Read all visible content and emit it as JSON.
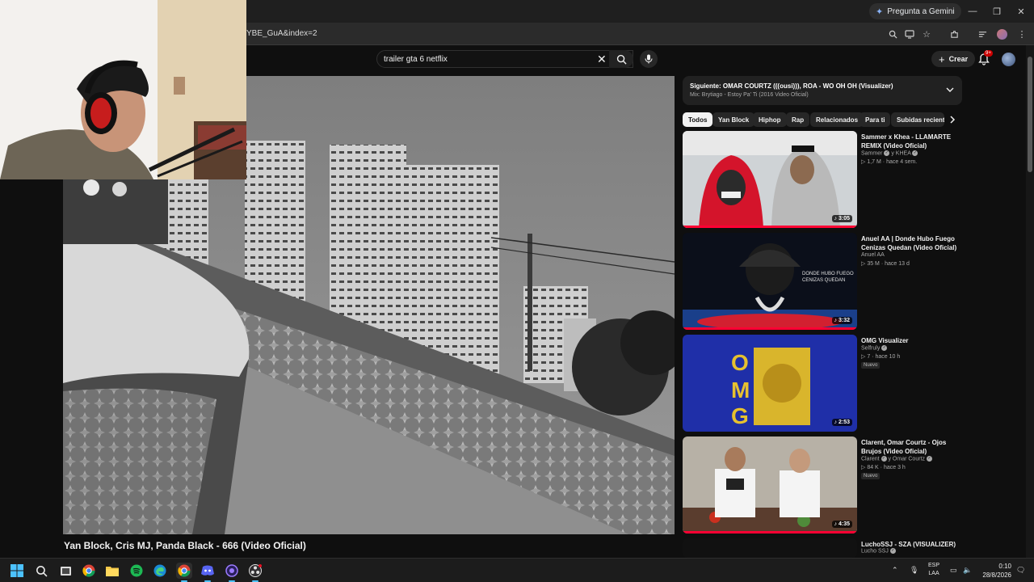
{
  "browser": {
    "gemini_label": "Pregunta a Gemini",
    "url_fragment": "YBE_GuA&index=2",
    "window_controls": [
      "minimize-icon",
      "restore-icon",
      "close-icon"
    ]
  },
  "youtube": {
    "search_value": "trailer gta 6 netflix",
    "create_label": "Crear",
    "notif_count": "9+",
    "video_title": "Yan Block, Cris MJ, Panda Black - 666 (Video Oficial)",
    "playlist": {
      "next": "Siguiente: OMAR COURTZ (((ousi))), ROA - WO OH OH (Visualizer)",
      "mix": "Mix: Brytiago - Estoy Pa' Ti (2016 Video Oficial)"
    },
    "chips": [
      "Todos",
      "Yan Block",
      "Hiphop",
      "Rap",
      "Relacionados",
      "Para ti",
      "Subidas recientes"
    ],
    "recommendations": [
      {
        "title": "Sammer x Khea - LLAMARTE REMIX (Video Oficial)",
        "channel": "Sammer",
        "collab": "y KHEA",
        "views": "1,7 M",
        "age": "hace 4 sem.",
        "duration": "3:05",
        "badge": ""
      },
      {
        "title": "Anuel AA | Donde Hubo Fuego Cenizas Quedan (Video Oficial)",
        "channel": "Anuel AA",
        "collab": "",
        "views": "35 M",
        "age": "hace 13 d",
        "duration": "3:32",
        "badge": ""
      },
      {
        "title": "OMG Visualizer",
        "channel": "Selfruly",
        "collab": "",
        "views": "7",
        "age": "hace 10 h",
        "duration": "2:53",
        "badge": "Nuevo"
      },
      {
        "title": "Clarent, Omar Courtz - Ojos Brujos (Video Oficial)",
        "channel": "Clarent",
        "collab": "y Omar Courtz",
        "views": "84 K",
        "age": "hace 3 h",
        "duration": "4:35",
        "badge": "Nuevo"
      },
      {
        "title": "LuchoSSJ - SZA (VISUALIZER)",
        "channel": "Lucho SSJ",
        "collab": "",
        "views": "",
        "age": "",
        "duration": "",
        "badge": ""
      }
    ],
    "thumbnail_texts": {
      "anuel": "DONDE HUBO FUEGO\nCENIZAS QUEDAN",
      "omg": "OMG"
    }
  },
  "taskbar": {
    "lang_line1": "ESP",
    "lang_line2": "LAA",
    "time": "0:10",
    "date": "28/8/2026"
  },
  "colors": {
    "background": "#0f0f0f",
    "progress_red": "#ff0033",
    "chip_active": "#f1f1f1"
  }
}
